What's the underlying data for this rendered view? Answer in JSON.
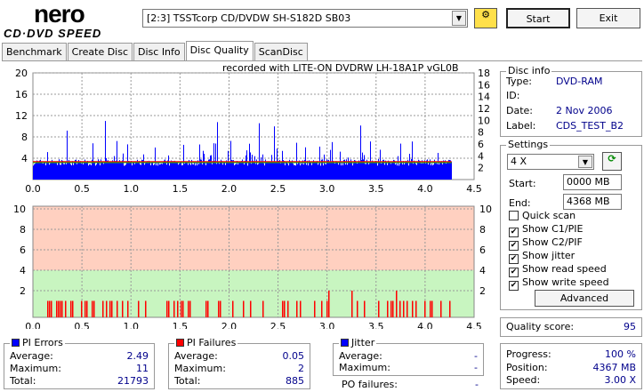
{
  "app": {
    "logo_top": "nero",
    "logo_bottom": "CD·DVD SPEED"
  },
  "toolbar": {
    "drive": "[2:3]  TSSTcorp CD/DVDW SH-S182D SB03",
    "start": "Start",
    "exit": "Exit"
  },
  "tabs": [
    {
      "label": "Benchmark"
    },
    {
      "label": "Create Disc"
    },
    {
      "label": "Disc Info"
    },
    {
      "label": "Disc Quality",
      "active": true
    },
    {
      "label": "ScanDisc"
    }
  ],
  "chart_header": "recorded with LITE-ON DVDRW LH-18A1P   vGL0B",
  "disc_info": {
    "title": "Disc info",
    "type_label": "Type:",
    "type": "DVD-RAM",
    "id_label": "ID:",
    "id": "",
    "date_label": "Date:",
    "date": "2 Nov 2006",
    "label_label": "Label:",
    "label": "CDS_TEST_B2"
  },
  "settings": {
    "title": "Settings",
    "speed": "4 X",
    "start_label": "Start:",
    "start": "0000 MB",
    "end_label": "End:",
    "end": "4368 MB",
    "checks": [
      {
        "label": "Quick scan",
        "checked": false
      },
      {
        "label": "Show C1/PIE",
        "checked": true
      },
      {
        "label": "Show C2/PIF",
        "checked": true
      },
      {
        "label": "Show jitter",
        "checked": true
      },
      {
        "label": "Show read speed",
        "checked": true
      },
      {
        "label": "Show write speed",
        "checked": true
      }
    ],
    "advanced": "Advanced"
  },
  "quality": {
    "label": "Quality score:",
    "value": "95"
  },
  "progress": {
    "progress_label": "Progress:",
    "progress": "100 %",
    "position_label": "Position:",
    "position": "4367 MB",
    "speed_label": "Speed:",
    "speed": "3.00 X"
  },
  "pi_errors": {
    "title": "PI Errors",
    "avg_label": "Average:",
    "avg": "2.49",
    "max_label": "Maximum:",
    "max": "11",
    "total_label": "Total:",
    "total": "21793"
  },
  "pi_failures": {
    "title": "PI Failures",
    "avg_label": "Average:",
    "avg": "0.05",
    "max_label": "Maximum:",
    "max": "2",
    "total_label": "Total:",
    "total": "885"
  },
  "jitter": {
    "title": "Jitter",
    "avg_label": "Average:",
    "avg": "-",
    "max_label": "Maximum:",
    "max": "-",
    "po_label": "PO failures:",
    "po": "-"
  },
  "colors": {
    "pie": "#0000ff",
    "pif": "#ff0000",
    "speed": "#ff0000",
    "bad": "#ffd0c0",
    "good": "#c8f5c0"
  },
  "chart_data": [
    {
      "type": "bar",
      "name": "PI Errors",
      "xlim": [
        0,
        4.5
      ],
      "ylim": [
        0,
        20
      ],
      "y2lim": [
        0,
        18
      ],
      "xticks": [
        "0.0",
        "0.5",
        "1.0",
        "1.5",
        "2.0",
        "2.5",
        "3.0",
        "3.5",
        "4.0",
        "4.5"
      ],
      "yticks": [
        "4",
        "8",
        "12",
        "16",
        "20"
      ],
      "y2ticks": [
        "2",
        "4",
        "6",
        "8",
        "10",
        "12",
        "14",
        "16",
        "18"
      ],
      "x_end": 4.27,
      "typical": 3,
      "max": 11,
      "read_speed": 3.0
    },
    {
      "type": "bar",
      "name": "PI Failures",
      "xlim": [
        0,
        4.5
      ],
      "ylim": [
        0,
        10
      ],
      "xticks": [
        "0.0",
        "0.5",
        "1.0",
        "1.5",
        "2.0",
        "2.5",
        "3.0",
        "3.5",
        "4.0",
        "4.5"
      ],
      "yticks": [
        "2",
        "4",
        "6",
        "8",
        "10"
      ],
      "y2ticks": [
        "2",
        "4",
        "6",
        "8",
        "10"
      ],
      "threshold": 4,
      "max": 2
    }
  ]
}
